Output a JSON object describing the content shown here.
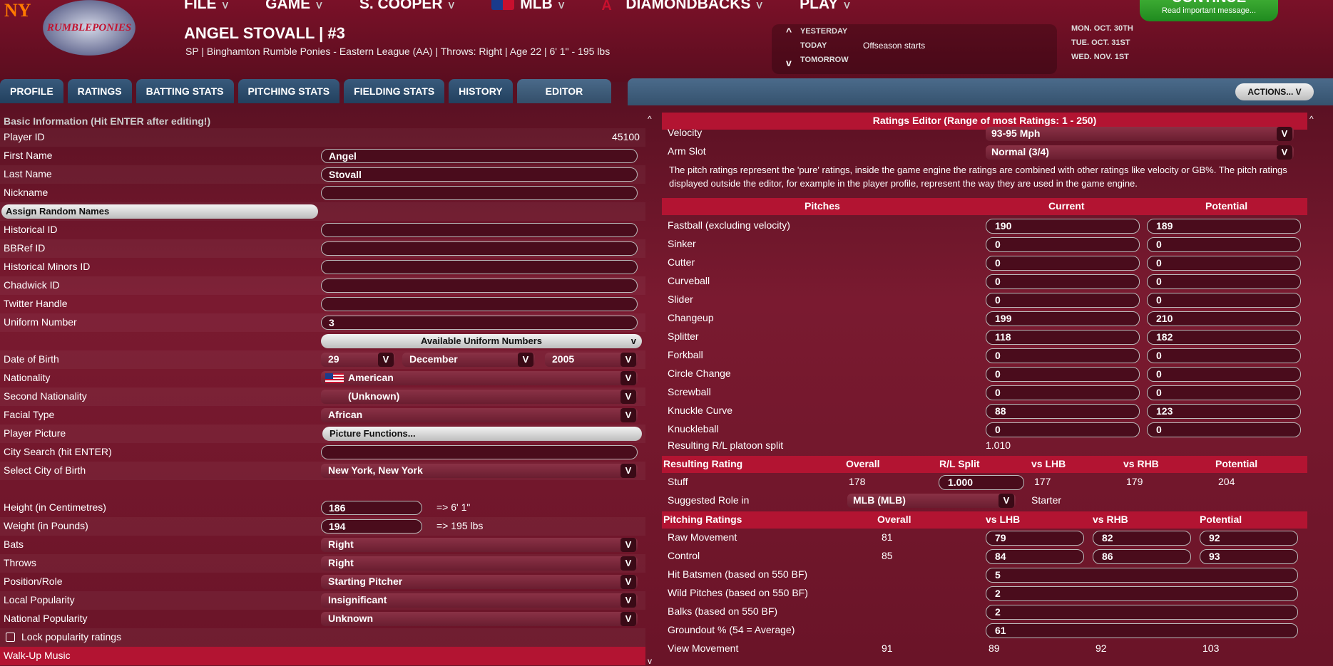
{
  "menu": {
    "file": "FILE",
    "game": "GAME",
    "manager": "S. COOPER",
    "mlb": "MLB",
    "team": "DIAMONDBACKS",
    "play": "PLAY"
  },
  "player": {
    "name": "ANGEL STOVALL  |  #3",
    "subtitle": "SP | Binghamton Rumble Ponies - Eastern League (AA)  |  Throws: Right  |  Age 22  |  6' 1\" - 195 lbs"
  },
  "team_logo_text": "RUMBLEPONIES",
  "org_logo_text": "NY",
  "calendar": {
    "yesterday": "YESTERDAY",
    "today": "TODAY",
    "tomorrow": "TOMORROW",
    "today_event": "Offseason starts",
    "d1": "MON. OCT. 30TH",
    "d2": "TUE. OCT. 31ST",
    "d3": "WED. NOV. 1ST"
  },
  "continue": {
    "label": "CONTINUE",
    "sub": "Read important message..."
  },
  "tabs": [
    "PROFILE",
    "RATINGS",
    "BATTING STATS",
    "PITCHING STATS",
    "FIELDING STATS",
    "HISTORY",
    "EDITOR"
  ],
  "actions": "ACTIONS...",
  "chev": "V",
  "left": {
    "title": "Basic Information (Hit ENTER after editing!)",
    "player_id_label": "Player ID",
    "player_id": "45100",
    "first_name_label": "First Name",
    "first_name": "Angel",
    "last_name_label": "Last Name",
    "last_name": "Stovall",
    "nickname_label": "Nickname",
    "assign_random": "Assign Random Names",
    "historical_id": "Historical ID",
    "bbref_id": "BBRef ID",
    "hist_minors_id": "Historical Minors ID",
    "chadwick_id": "Chadwick ID",
    "twitter": "Twitter Handle",
    "uniform_label": "Uniform Number",
    "uniform": "3",
    "available_uniform": "Available Uniform Numbers",
    "dob_label": "Date of Birth",
    "dob_day": "29",
    "dob_month": "December",
    "dob_year": "2005",
    "nationality_label": "Nationality",
    "nationality": "American",
    "second_nat_label": "Second Nationality",
    "second_nat": "(Unknown)",
    "facial_label": "Facial Type",
    "facial": "African",
    "picture_label": "Player Picture",
    "picture_btn": "Picture Functions...",
    "city_search_label": "City Search (hit ENTER)",
    "city_birth_label": "Select City of Birth",
    "city_birth": "New York, New York",
    "height_label": "Height (in Centimetres)",
    "height": "186",
    "height_conv": "=> 6' 1\"",
    "weight_label": "Weight (in Pounds)",
    "weight": "194",
    "weight_conv": "=> 195 lbs",
    "bats_label": "Bats",
    "bats": "Right",
    "throws_label": "Throws",
    "throws": "Right",
    "position_label": "Position/Role",
    "position": "Starting Pitcher",
    "local_pop_label": "Local Popularity",
    "local_pop": "Insignificant",
    "nat_pop_label": "National Popularity",
    "nat_pop": "Unknown",
    "lock_label": "Lock popularity ratings",
    "walkup_label": "Walk-Up Music"
  },
  "right": {
    "header": "Ratings Editor (Range of most Ratings: 1 - 250)",
    "velocity_label": "Velocity",
    "velocity": "93-95 Mph",
    "armslot_label": "Arm Slot",
    "armslot": "Normal (3/4)",
    "note": "The pitch ratings represent the 'pure' ratings, inside the game engine the ratings are combined with other ratings like velocity or GB%. The pitch ratings displayed outside the editor, for example in the player profile, represent the way they are used in the game engine.",
    "pitches_header": {
      "pitches": "Pitches",
      "current": "Current",
      "potential": "Potential"
    },
    "pitches": [
      {
        "name": "Fastball (excluding velocity)",
        "current": "190",
        "potential": "189"
      },
      {
        "name": "Sinker",
        "current": "0",
        "potential": "0"
      },
      {
        "name": "Cutter",
        "current": "0",
        "potential": "0"
      },
      {
        "name": "Curveball",
        "current": "0",
        "potential": "0"
      },
      {
        "name": "Slider",
        "current": "0",
        "potential": "0"
      },
      {
        "name": "Changeup",
        "current": "199",
        "potential": "210"
      },
      {
        "name": "Splitter",
        "current": "118",
        "potential": "182"
      },
      {
        "name": "Forkball",
        "current": "0",
        "potential": "0"
      },
      {
        "name": "Circle Change",
        "current": "0",
        "potential": "0"
      },
      {
        "name": "Screwball",
        "current": "0",
        "potential": "0"
      },
      {
        "name": "Knuckle Curve",
        "current": "88",
        "potential": "123"
      },
      {
        "name": "Knuckleball",
        "current": "0",
        "potential": "0"
      }
    ],
    "platoon_label": "Resulting R/L platoon split",
    "platoon": "1.010",
    "resulting_header": {
      "title": "Resulting Rating",
      "overall": "Overall",
      "rl": "R/L Split",
      "vsl": "vs LHB",
      "vsr": "vs RHB",
      "pot": "Potential"
    },
    "stuff": {
      "label": "Stuff",
      "overall": "178",
      "rl": "1.000",
      "vsl": "177",
      "vsr": "179",
      "pot": "204"
    },
    "suggested_label": "Suggested Role in",
    "suggested_league": "MLB (MLB)",
    "suggested_role": "Starter",
    "pitching_header": {
      "title": "Pitching Ratings",
      "overall": "Overall",
      "vsl": "vs LHB",
      "vsr": "vs RHB",
      "pot": "Potential"
    },
    "raw_movement": {
      "label": "Raw Movement",
      "overall": "81",
      "vsl": "79",
      "vsr": "82",
      "pot": "92"
    },
    "control": {
      "label": "Control",
      "overall": "85",
      "vsl": "84",
      "vsr": "86",
      "pot": "93"
    },
    "hbp_label": "Hit Batsmen (based on 550 BF)",
    "hbp": "5",
    "wp_label": "Wild Pitches (based on 550 BF)",
    "wp": "2",
    "balks_label": "Balks (based on 550 BF)",
    "balks": "2",
    "gb_label": "Groundout % (54 = Average)",
    "gb": "61",
    "view_movement": {
      "label": "View Movement",
      "overall": "91",
      "vsl": "89",
      "vsr": "92",
      "pot": "103"
    }
  }
}
